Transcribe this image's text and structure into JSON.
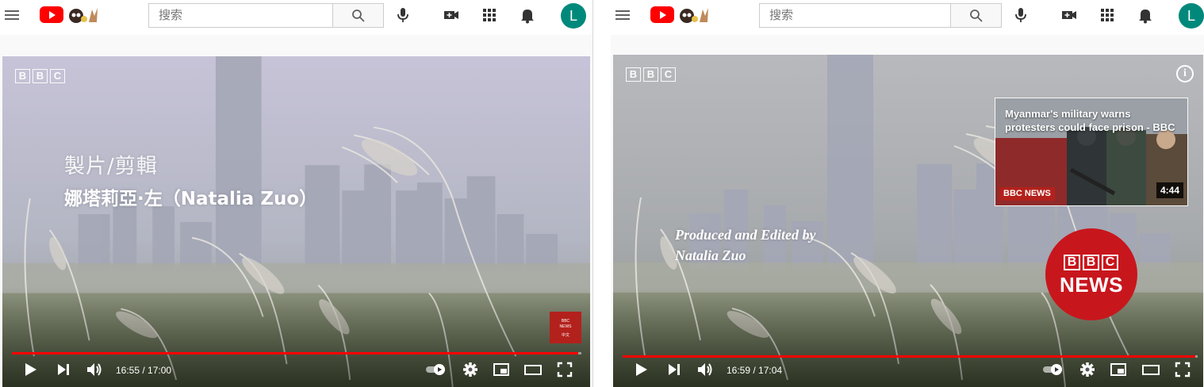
{
  "left": {
    "search": {
      "placeholder": "搜索"
    },
    "avatar_letter": "L",
    "watermark": [
      "B",
      "B",
      "C"
    ],
    "credit_role": "製片/剪輯",
    "credit_name": "娜塔莉亞·左（Natalia Zuo）",
    "news_chip": {
      "line1": "BBC",
      "line2": "NEWS",
      "line3": "中文"
    },
    "time_current": "16:55",
    "time_separator": " / ",
    "time_total": "17:00",
    "progress": 0.995
  },
  "right": {
    "search": {
      "placeholder": "搜索"
    },
    "avatar_letter": "L",
    "watermark": [
      "B",
      "B",
      "C"
    ],
    "credit_line1": "Produced and Edited by",
    "credit_line2": "Natalia Zuo",
    "info_glyph": "i",
    "endcard": {
      "title": "Myanmar's military warns protesters could face prison - BBC News",
      "logo": "BBC NEWS",
      "duration": "4:44"
    },
    "bbc_news_logo": {
      "letters": [
        "B",
        "B",
        "C"
      ],
      "word": "NEWS"
    },
    "time_current": "16:59",
    "time_separator": " / ",
    "time_total": "17:04",
    "progress": 0.996
  },
  "colors": {
    "youtube_red": "#ff0000",
    "bbc_red": "#c8161d",
    "avatar": "#00897b",
    "progress_fill": "#ff0000"
  },
  "icons": [
    "menu-icon",
    "youtube-logo",
    "search-icon",
    "mic-icon",
    "create-video-icon",
    "apps-icon",
    "notifications-icon",
    "play-icon",
    "next-icon",
    "volume-icon",
    "autoplay-toggle",
    "settings-icon",
    "miniplayer-icon",
    "theater-mode-icon",
    "fullscreen-icon",
    "info-icon"
  ]
}
